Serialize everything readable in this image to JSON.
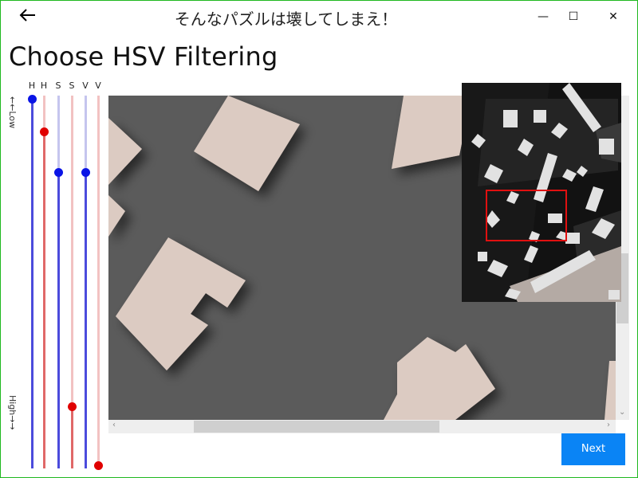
{
  "window": {
    "title": "そんなパズルは壊してしまえ！",
    "back_icon": "arrow-left-icon",
    "minimize_glyph": "—",
    "maximize_glyph": "☐",
    "close_glyph": "✕"
  },
  "page": {
    "heading": "Choose HSV Filtering"
  },
  "sliders": {
    "low_label": "←←Low",
    "high_label": "High→→",
    "items": [
      {
        "label": "H",
        "color": "#4b4bdc",
        "value": 0.0
      },
      {
        "label": "H",
        "color": "#e06868",
        "value": 0.09
      },
      {
        "label": "S",
        "color": "#4b4bdc",
        "value": 0.2
      },
      {
        "label": "S",
        "color": "#e06868",
        "value": 0.84
      },
      {
        "label": "V",
        "color": "#4b4bdc",
        "value": 0.2
      },
      {
        "label": "V",
        "color": "#e06868",
        "value": 1.0
      }
    ]
  },
  "scroll": {
    "left_arrow": "‹",
    "right_arrow": "›",
    "down_arrow": "⌄"
  },
  "actions": {
    "next_label": "Next"
  },
  "colors": {
    "accent": "#0a84f5",
    "piece": "#dccbc2",
    "background": "#5b5b5b"
  }
}
